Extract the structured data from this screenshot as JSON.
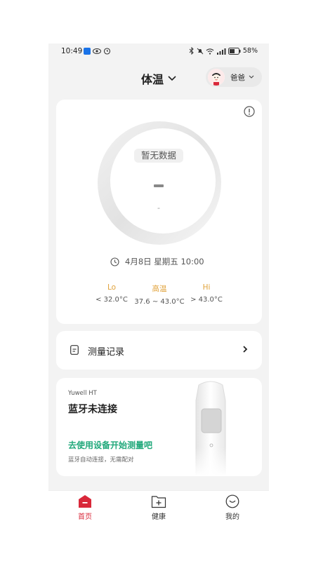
{
  "status_bar": {
    "time": "10:49",
    "battery": "58%"
  },
  "header": {
    "title": "体温",
    "profile_name": "爸爸"
  },
  "measurement": {
    "empty_badge": "暂无数据",
    "value": "-",
    "unit": "-",
    "datetime": "4月8日 星期五 10:00",
    "ranges": [
      {
        "label": "Lo",
        "value": "< 32.0°C"
      },
      {
        "label": "高温",
        "value": "37.6 ~ 43.0°C"
      },
      {
        "label": "Hi",
        "value": "> 43.0°C"
      }
    ]
  },
  "records": {
    "label": "测量记录"
  },
  "device": {
    "model": "Yuwell HT",
    "status": "蓝牙未连接",
    "cta": "去使用设备开始测量吧",
    "hint": "蓝牙自动连接，无需配对"
  },
  "tabs": [
    {
      "label": "首页",
      "active": true
    },
    {
      "label": "健康",
      "active": false
    },
    {
      "label": "我的",
      "active": false
    }
  ],
  "colors": {
    "accent": "#d9283a",
    "range_label": "#e0a23a",
    "cta": "#1fa87a"
  }
}
